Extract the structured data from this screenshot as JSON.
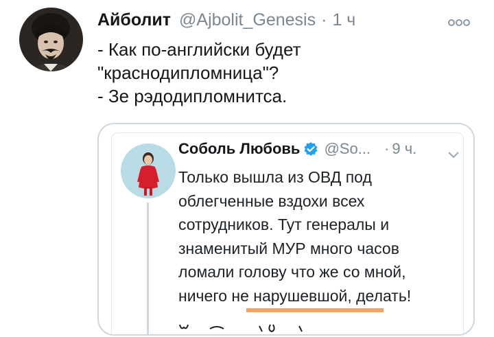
{
  "tweet": {
    "author_name": "Айболит",
    "author_handle": "@Ajbolit_Genesis",
    "separator": "·",
    "timestamp": "1 ч",
    "text_lines": [
      "- Как по-английски будет",
      "\"краснодипломница\"?",
      "- Зе рэдодипломнитса."
    ],
    "more_icon": "more-dots-icon"
  },
  "quote": {
    "author_name": "Соболь Любовь",
    "author_handle": "@So...",
    "separator": "·",
    "timestamp": "9 ч.",
    "verified_icon": "verified-badge-icon",
    "chevron_icon": "chevron-down-icon",
    "text_lines": [
      "Только вышла из ОВД под",
      "облегченные вздохи всех",
      "сотрудников. Тут генералы и",
      "знаменитый МУР много часов",
      "ломали голову что же со мной,",
      "ничего не нарушевшой, делать!"
    ]
  },
  "colors": {
    "text": "#14171a",
    "secondary": "#7b8790",
    "border": "#cfd8de",
    "verified": "#1da1f2",
    "highlight": "#f5a463"
  }
}
